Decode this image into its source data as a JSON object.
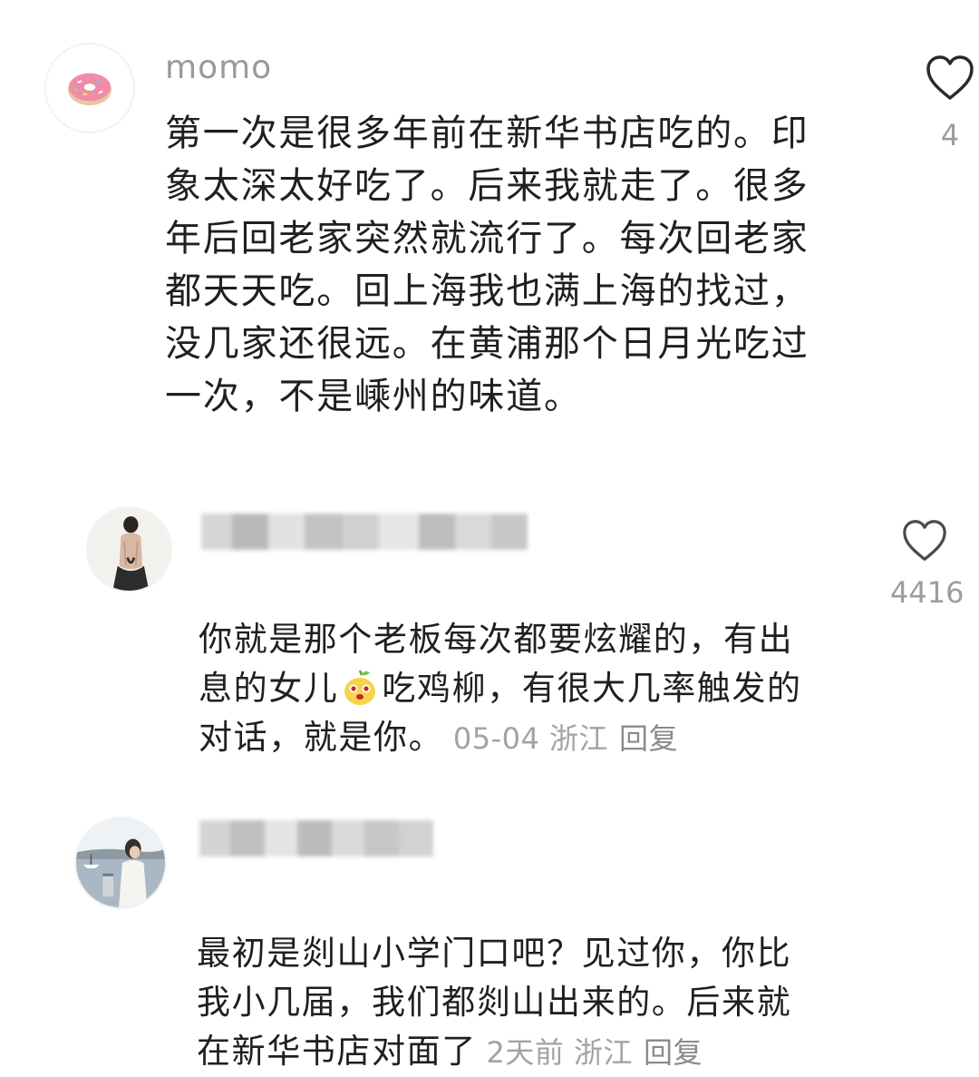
{
  "comments": [
    {
      "username": "momo",
      "text": "第一次是很多年前在新华书店吃的。印\n象太深太好吃了。后来我就走了。很多\n年后回老家突然就流行了。每次回老家\n都天天吃。回上海我也满上海的找过，\n没几家还很远。在黄浦那个日月光吃过\n一次，不是嵊州的味道。",
      "likes": "4",
      "avatar_icon": "donut-icon"
    },
    {
      "username": "",
      "text_part1": "你就是那个老板每次都要炫耀的，有出\n息的女儿",
      "emoji_icon": "pear-face-emoji-icon",
      "text_part2": "吃鸡柳，有很大几率触发的\n对话，就是你。",
      "date": "05-04",
      "location": "浙江",
      "reply_label": "回复",
      "likes": "4416",
      "avatar_icon": "woman-back-photo-icon"
    },
    {
      "username": "",
      "text": "最初是剡山小学门口吧？见过你，你比\n我小几届，我们都剡山出来的。后来就\n在新华书店对面了",
      "date": "2天前",
      "location": "浙江",
      "reply_label": "回复",
      "avatar_icon": "woman-lakeside-photo-icon"
    }
  ],
  "colors": {
    "text": "#1f1f1f",
    "meta": "#a3a3a3",
    "username": "#9a9a9a",
    "donut_frosting": "#f08ca8"
  }
}
